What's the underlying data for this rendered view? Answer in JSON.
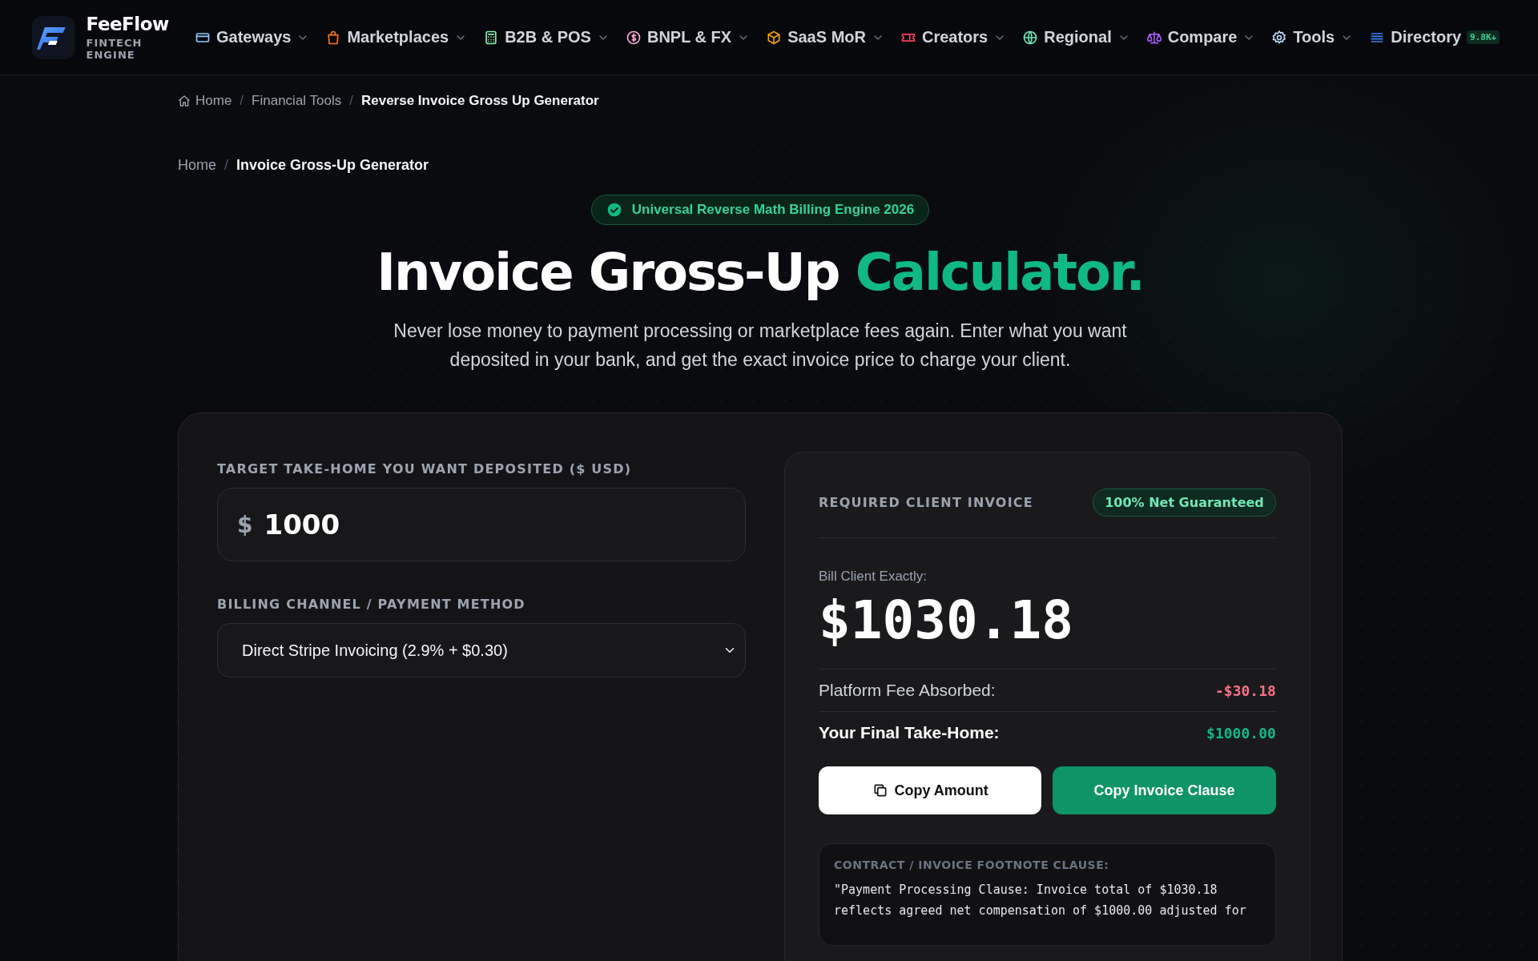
{
  "brand": {
    "name": "FeeFlow",
    "tagline": "FINTECH ENGINE"
  },
  "nav": [
    {
      "label": "Gateways",
      "dropdown": true
    },
    {
      "label": "Marketplaces",
      "dropdown": true
    },
    {
      "label": "B2B & POS",
      "dropdown": true
    },
    {
      "label": "BNPL & FX",
      "dropdown": true
    },
    {
      "label": "SaaS MoR",
      "dropdown": true
    },
    {
      "label": "Creators",
      "dropdown": true
    },
    {
      "label": "Regional",
      "dropdown": true
    },
    {
      "label": "Compare",
      "dropdown": true
    },
    {
      "label": "Tools",
      "dropdown": true
    },
    {
      "label": "Directory",
      "dropdown": false,
      "badge": "9.8K+"
    }
  ],
  "breadcrumb_top": {
    "separator": "/",
    "items": [
      "Home",
      "Financial Tools",
      "Reverse Invoice Gross Up Generator"
    ]
  },
  "breadcrumb": {
    "separator": "/",
    "items": [
      "Home",
      "Invoice Gross-Up Generator"
    ]
  },
  "hero": {
    "badge": "Universal Reverse Math Billing Engine 2026",
    "title": "Invoice Gross-Up",
    "title_accent": "Calculator.",
    "subtitle": "Never lose money to payment processing or marketplace fees again. Enter what you want deposited in your bank, and get the exact invoice price to charge your client."
  },
  "form": {
    "amount_label": "TARGET TAKE-HOME YOU WANT DEPOSITED ($ USD)",
    "currency": "$",
    "amount": "1000",
    "method_label": "BILLING CHANNEL / PAYMENT METHOD",
    "method": "Direct Stripe Invoicing (2.9% + $0.30)"
  },
  "result": {
    "heading": "REQUIRED CLIENT INVOICE",
    "badge": "100% Net Guaranteed",
    "amount_label": "Bill Client Exactly:",
    "amount": "$1030.18",
    "rows": [
      {
        "label": "Platform Fee Absorbed:",
        "value": "-$30.18",
        "kind": "fee"
      },
      {
        "label": "Your Final Take-Home:",
        "value": "$1000.00",
        "kind": "net"
      }
    ],
    "buttons": [
      {
        "label": "Copy Amount",
        "kind": "secondary"
      },
      {
        "label": "Copy Invoice Clause",
        "kind": "primary"
      }
    ],
    "clause_heading": "CONTRACT / INVOICE FOOTNOTE CLAUSE:",
    "clause": "\"Payment Processing Clause: Invoice total of $1030.18 reflects agreed net compensation of $1000.00 adjusted for"
  }
}
